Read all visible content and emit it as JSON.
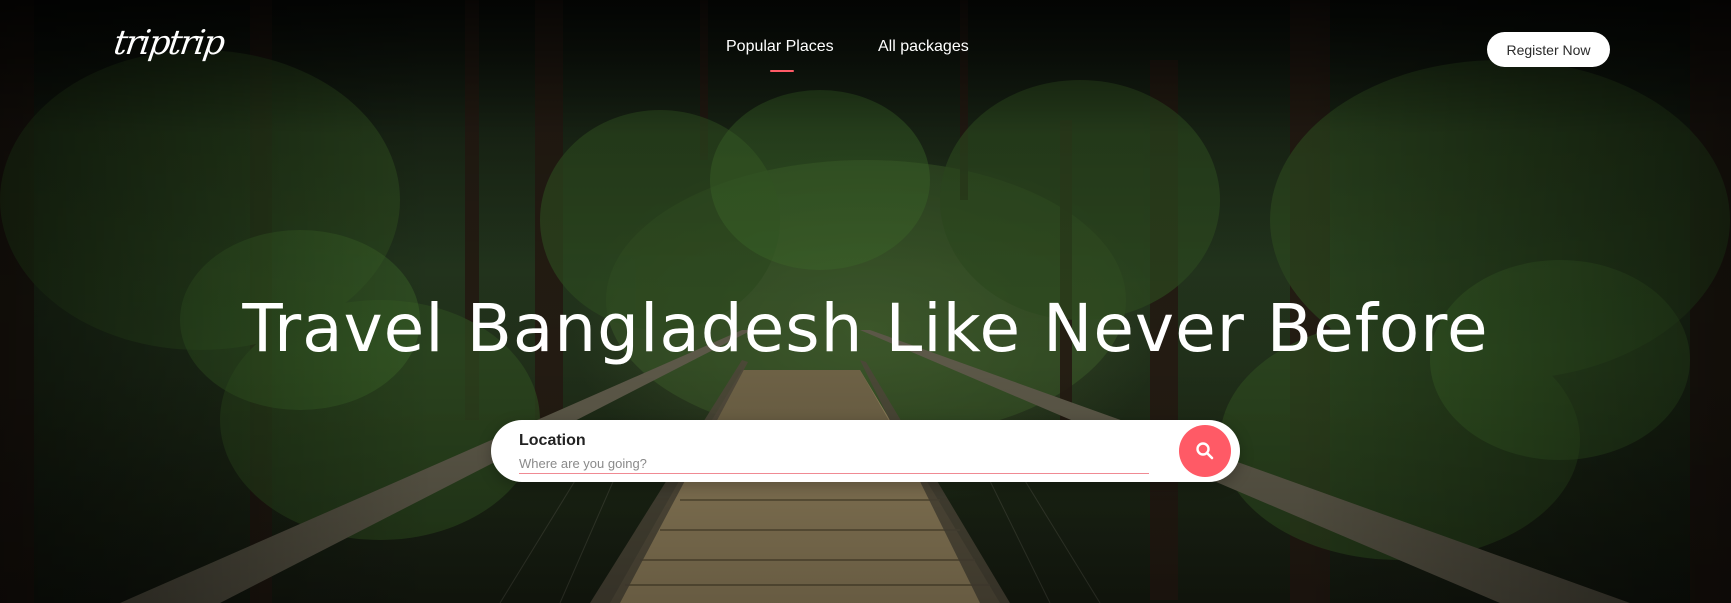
{
  "brand": {
    "logo_text": "triptrip"
  },
  "nav": {
    "items": [
      {
        "label": "Popular Places",
        "active": true
      },
      {
        "label": "All packages",
        "active": false
      }
    ]
  },
  "header": {
    "register_label": "Register Now"
  },
  "hero": {
    "headline": "Travel Bangladesh Like Never Before"
  },
  "search": {
    "label": "Location",
    "placeholder": "Where are you going?",
    "button_icon": "search-icon"
  },
  "colors": {
    "accent": "#ff5a66",
    "text_on_dark": "#ffffff",
    "button_bg": "#ffffff"
  }
}
